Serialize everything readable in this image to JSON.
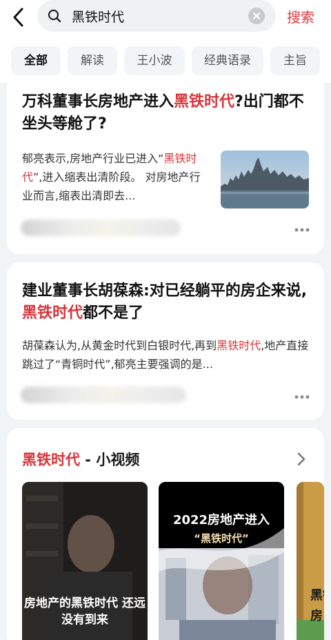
{
  "search": {
    "query": "黑铁时代",
    "submit_label": "搜索"
  },
  "tabs": [
    {
      "label": "全部",
      "active": true
    },
    {
      "label": "解读"
    },
    {
      "label": "王小波"
    },
    {
      "label": "经典语录"
    },
    {
      "label": "主旨"
    }
  ],
  "results": [
    {
      "title_pre": "万科董事长房地产进入",
      "title_hl": "黑铁时代",
      "title_post": "?出门都不坐头等舱了?",
      "summary_pre": "郁亮表示,房地产行业已进入“",
      "summary_hl": "黑铁时代",
      "summary_post": "”,进入缩表出清阶段。 对房地产行业而言,缩表出清即去..."
    },
    {
      "title_pre": "建业董事长胡葆森:对已经躺平的房企来说,",
      "title_hl": "黑铁时代",
      "title_post": "都不是了",
      "summary_pre": "胡葆森认为,从黄金时代到白银时代,再到",
      "summary_hl": "黑铁时代",
      "summary_post": ",地产直接跳过了“青铜时代”,郁亮主要强调的是..."
    }
  ],
  "videos_section": {
    "title_hl": "黑铁时代",
    "title_rest": " - 小视频",
    "videos": [
      {
        "caption": "房地产的黑铁时代 还远没有到来"
      },
      {
        "caption_top": "2022房地产进入",
        "caption_sub": "“黑铁时代”"
      },
      {
        "caption": "黑铁 房"
      }
    ]
  },
  "colors": {
    "accent": "#d8343a",
    "page_bg": "#f2f3f5"
  },
  "icons": {
    "back": "chevron-left-icon",
    "search": "search-icon",
    "clear": "close-circle-icon",
    "more": "more-dots-icon",
    "section_arrow": "chevron-right-icon"
  }
}
